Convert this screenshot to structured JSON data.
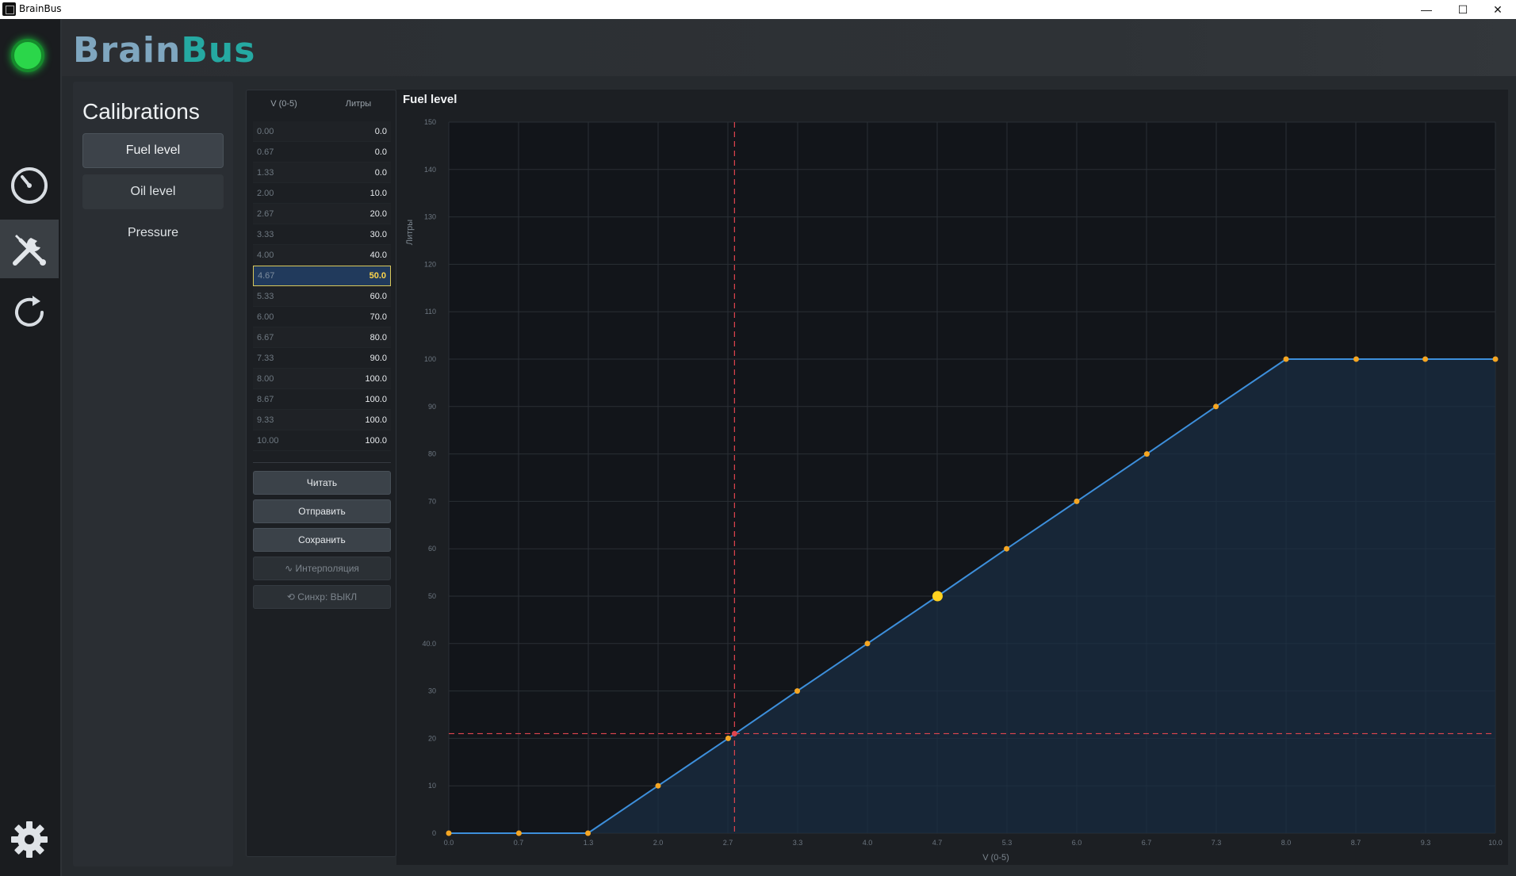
{
  "window": {
    "title": "BrainBus",
    "minimize_glyph": "—",
    "maximize_glyph": "☐",
    "close_glyph": "✕"
  },
  "rail": {
    "status_color": "#2bd64a",
    "icons": [
      "gauge-icon",
      "tools-icon",
      "refresh-icon",
      "settings-icon"
    ],
    "active": "tools-icon"
  },
  "header": {
    "logo_part1": "Brain",
    "logo_part2": "Bus",
    "logo_color1": "#7fa6bf",
    "logo_color2": "#25a9a2"
  },
  "calibrations": {
    "title": "Calibrations",
    "items": [
      {
        "label": "Fuel level"
      },
      {
        "label": "Oil level"
      },
      {
        "label": "Pressure"
      }
    ],
    "selected": "Fuel level"
  },
  "table": {
    "headers": [
      "V (0-5)",
      "Литры"
    ],
    "rows": [
      {
        "v": "0.00",
        "l": "0.0"
      },
      {
        "v": "0.67",
        "l": "0.0"
      },
      {
        "v": "1.33",
        "l": "0.0"
      },
      {
        "v": "2.00",
        "l": "10.0"
      },
      {
        "v": "2.67",
        "l": "20.0"
      },
      {
        "v": "3.33",
        "l": "30.0"
      },
      {
        "v": "4.00",
        "l": "40.0"
      },
      {
        "v": "4.67",
        "l": "50.0"
      },
      {
        "v": "5.33",
        "l": "60.0"
      },
      {
        "v": "6.00",
        "l": "70.0"
      },
      {
        "v": "6.67",
        "l": "80.0"
      },
      {
        "v": "7.33",
        "l": "90.0"
      },
      {
        "v": "8.00",
        "l": "100.0"
      },
      {
        "v": "8.67",
        "l": "100.0"
      },
      {
        "v": "9.33",
        "l": "100.0"
      },
      {
        "v": "10.00",
        "l": "100.0"
      }
    ],
    "selected_index": 7
  },
  "actions": {
    "read": "Читать",
    "send": "Отправить",
    "save": "Сохранить",
    "interpolation": "∿ Интерполяция",
    "sync": "⟲ Синхр: ВЫКЛ"
  },
  "chart_data": {
    "type": "line",
    "title": "Fuel level",
    "xlabel": "V (0-5)",
    "ylabel": "Литры",
    "xlim": [
      0,
      10
    ],
    "ylim": [
      0,
      150
    ],
    "x_ticks": [
      "0.0",
      "0.7",
      "1.3",
      "2.0",
      "2.7",
      "3.3",
      "4.0",
      "4.7",
      "5.3",
      "6.0",
      "6.7",
      "7.3",
      "8.0",
      "8.7",
      "9.3",
      "10.0"
    ],
    "y_ticks": [
      "0",
      "10",
      "20",
      "30",
      "40.0",
      "50",
      "60",
      "70",
      "80",
      "90",
      "100",
      "110",
      "120",
      "130",
      "140",
      "150"
    ],
    "series": [
      {
        "x": [
          0.0,
          0.67,
          1.33,
          2.0,
          2.67,
          3.33,
          4.0,
          4.67,
          5.33,
          6.0,
          6.67,
          7.33,
          8.0,
          8.67,
          9.33,
          10.0
        ],
        "values": [
          0,
          0,
          0,
          10,
          20,
          30,
          40,
          50,
          60,
          70,
          80,
          90,
          100,
          100,
          100,
          100
        ]
      }
    ],
    "highlight_index": 7,
    "crosshair": {
      "x": 2.73,
      "y": 21
    },
    "grid": true,
    "line_color": "#3d8fdb",
    "point_color": "#f5a623",
    "highlight_color": "#ffd21f",
    "crosshair_color": "#e0454f"
  }
}
